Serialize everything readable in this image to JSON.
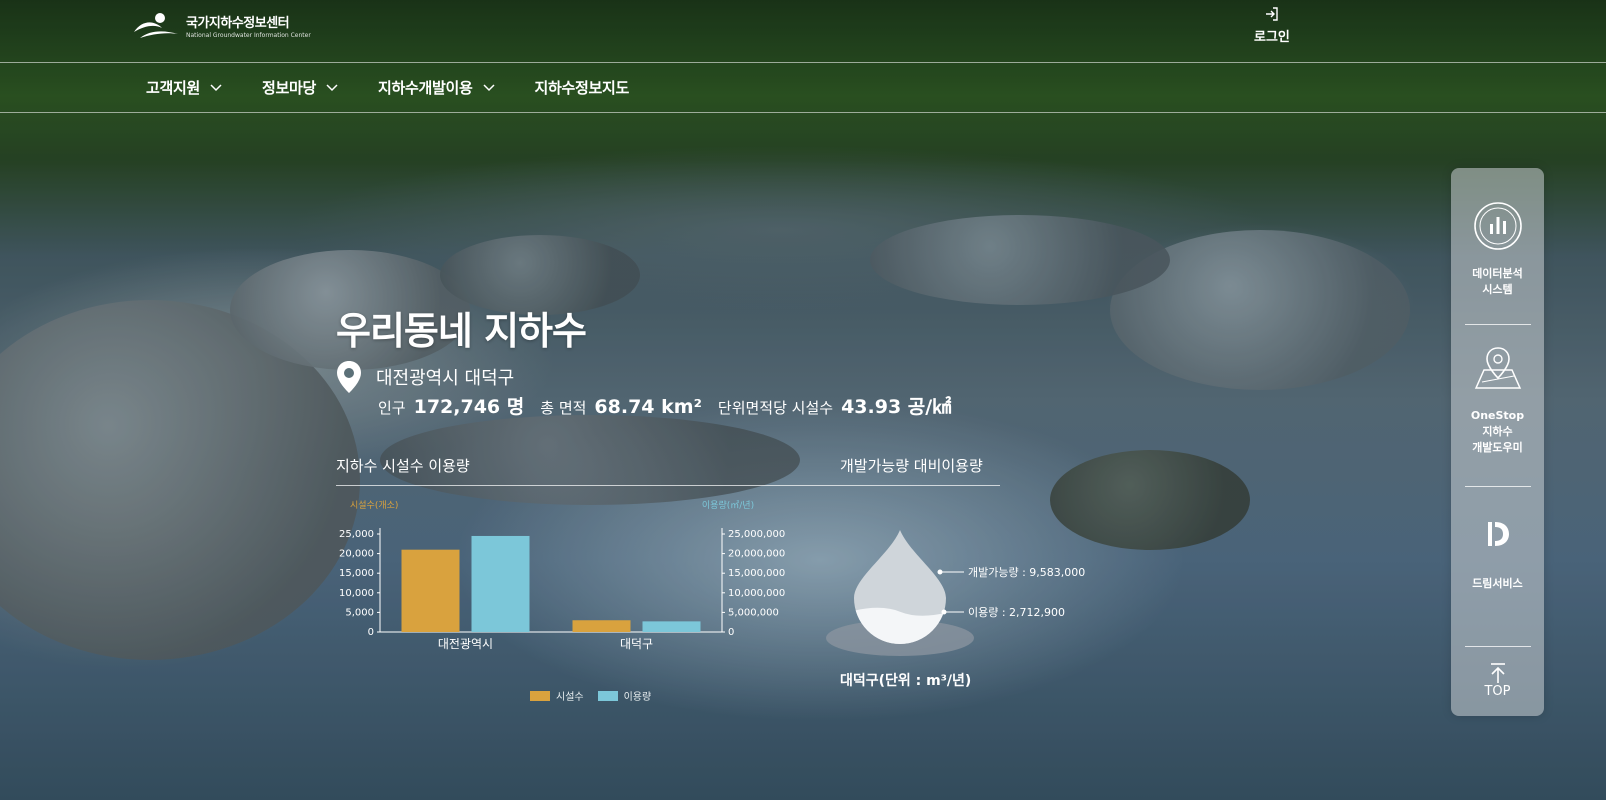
{
  "header": {
    "logo_ko": "국가지하수정보센터",
    "logo_en": "National Groundwater Information Center",
    "login_label": "로그인"
  },
  "nav": {
    "items": [
      {
        "label": "고객지원",
        "has_dropdown": true
      },
      {
        "label": "정보마당",
        "has_dropdown": true
      },
      {
        "label": "지하수개발이용",
        "has_dropdown": true
      },
      {
        "label": "지하수정보지도",
        "has_dropdown": false
      }
    ]
  },
  "hero": {
    "title": "우리동네 지하수",
    "location": "대전광역시 대덕구",
    "stats": [
      {
        "label": "인구",
        "value": "172,746 명"
      },
      {
        "label": "총 면적",
        "value": "68.74 km²"
      },
      {
        "label": "단위면적당 시설수",
        "value": "43.93 공/㎢"
      }
    ]
  },
  "section_left_title": "지하수 시설수 이용량",
  "section_right_title": "개발가능량 대비이용량",
  "colors": {
    "facilities": "#d9a23e",
    "usage": "#7cc7d9",
    "panel": "#c8cdd2"
  },
  "chart_data": [
    {
      "type": "bar",
      "ylabel": "시설수(개소)",
      "y2label": "이용량(㎥/년)",
      "categories": [
        "대전광역시",
        "대덕구"
      ],
      "series": [
        {
          "name": "시설수",
          "axis": "left",
          "values": [
            21000,
            3000
          ]
        },
        {
          "name": "이용량",
          "axis": "right",
          "values": [
            24500000,
            2712900
          ]
        }
      ],
      "ylim": [
        0,
        25000
      ],
      "y2lim": [
        0,
        25000000
      ],
      "yticks": [
        "0",
        "5,000",
        "10,000",
        "15,000",
        "20,000",
        "25,000"
      ],
      "y2ticks": [
        "0",
        "5,000,000",
        "10,000,000",
        "15,000,000",
        "20,000,000",
        "25,000,000"
      ],
      "legend": "bottom",
      "grid": false
    },
    {
      "type": "area",
      "caption": "대덕구(단위 : m³/년)",
      "labels": {
        "capacity": "개발가능량 : 9,583,000",
        "usage": "이용량 : 2,712,900"
      },
      "capacity": 9583000,
      "usage": 2712900
    }
  ],
  "quick_menu": {
    "items": [
      {
        "label_line1": "데이터분석",
        "label_line2": "시스템",
        "icon": "bar-chart-circle-icon"
      },
      {
        "label_line1": "OneStop",
        "label_line2": "지하수",
        "label_line3": "개발도우미",
        "icon": "map-pin-icon"
      },
      {
        "label_line1": "드림서비스",
        "icon": "dream-logo-icon"
      }
    ],
    "top_label": "TOP"
  }
}
